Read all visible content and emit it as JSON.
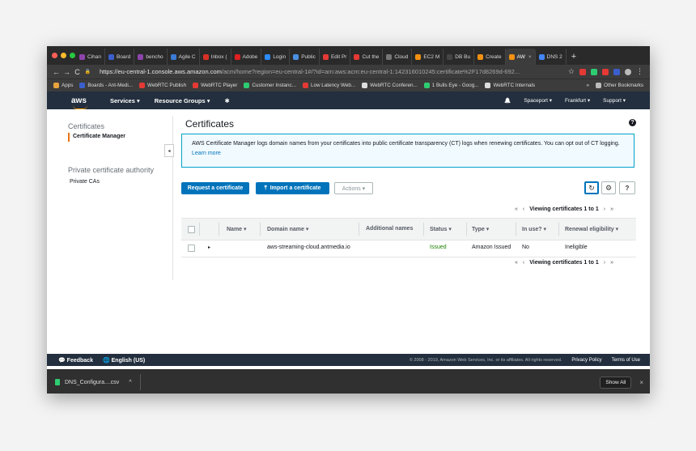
{
  "browser": {
    "tabs": [
      {
        "label": "Cihan",
        "color": "#8e44ad"
      },
      {
        "label": "Board",
        "color": "#3a5fcd"
      },
      {
        "label": "bencho",
        "color": "#8e44ad"
      },
      {
        "label": "Agile C",
        "color": "#3a7bd5"
      },
      {
        "label": "Inbox (",
        "color": "#d93025"
      },
      {
        "label": "Adobe",
        "color": "#e02020"
      },
      {
        "label": "Login",
        "color": "#2d8cff"
      },
      {
        "label": "Public",
        "color": "#4a90e2"
      },
      {
        "label": "Edit Pr",
        "color": "#e53935"
      },
      {
        "label": "Cut the",
        "color": "#e53935"
      },
      {
        "label": "Cloud",
        "color": "#777777"
      },
      {
        "label": "EC2 M",
        "color": "#f29111"
      },
      {
        "label": "DB Bu",
        "color": "#444444"
      },
      {
        "label": "Create",
        "color": "#f29111"
      },
      {
        "label": "AW",
        "color": "#f29111"
      },
      {
        "label": "DNS 2",
        "color": "#4285f4"
      }
    ],
    "new_tab": "+",
    "close_tab": "×",
    "back": "←",
    "forward": "→",
    "reload": "C",
    "lock": "🔒",
    "star": "☆",
    "url_host": "https://eu-central-1.console.aws.amazon.com",
    "url_path": "/acm/home?region=eu-central-1#/?id=arn:aws:acm:eu-central-1:142316010245:certificate%2F17d8269d-692...",
    "menu": "⋮",
    "bookmarks": [
      {
        "label": "Apps",
        "color": "#e8a33d"
      },
      {
        "label": "Boards - Ant-Medi...",
        "color": "#3a5fcd"
      },
      {
        "label": "WebRTC Publish",
        "color": "#e53935"
      },
      {
        "label": "WebRTC Player",
        "color": "#e53935"
      },
      {
        "label": "Customer Instanc...",
        "color": "#2ecc71"
      },
      {
        "label": "Low Latency Web...",
        "color": "#e53935"
      },
      {
        "label": "WebRTC Conferen...",
        "color": "#dddddd"
      },
      {
        "label": "1 Bulls Eye - Goog...",
        "color": "#2ecc71"
      },
      {
        "label": "WebRTC Internals",
        "color": "#dddddd"
      }
    ],
    "more_bookmarks": "»",
    "other_bookmarks": "Other Bookmarks"
  },
  "aws_nav": {
    "logo": "aws",
    "services": "Services",
    "resource_groups": "Resource Groups",
    "chevron": "▾",
    "pin": "✱",
    "bell": "🔔",
    "account": "Spaceport",
    "region": "Frankfurt",
    "support": "Support"
  },
  "sidebar": {
    "section1_title": "Certificates",
    "section1_item": "Certificate Manager",
    "section2_title": "Private certificate authority",
    "section2_item": "Private CAs",
    "collapse": "◂"
  },
  "main": {
    "title": "Certificates",
    "help": "?",
    "info_text": "AWS Certificate Manager logs domain names from your certificates into public certificate transparency (CT) logs when renewing certificates. You can opt out of CT logging.",
    "info_link": "Learn more",
    "request_button": "Request a certificate",
    "import_button": "Import a certificate",
    "import_icon": "⤒",
    "actions_button": "Actions ▾",
    "refresh": "↻",
    "settings": "⚙",
    "pager": {
      "first": "«",
      "prev": "‹",
      "text": "Viewing certificates 1 to 1",
      "next": "›",
      "last": "»"
    },
    "columns": [
      "Name",
      "Domain name",
      "Additional names",
      "Status",
      "Type",
      "In use?",
      "Renewal eligibility"
    ],
    "sort_icon": "▾",
    "row": {
      "expand": "▸",
      "name": "",
      "domain": "aws-streaming-cloud.antmedia.io",
      "additional": "",
      "status": "Issued",
      "type": "Amazon Issued",
      "in_use": "No",
      "renewal": "Ineligible"
    }
  },
  "footer": {
    "feedback": "Feedback",
    "language": "English (US)",
    "copyright": "© 2008 - 2019, Amazon Web Services, Inc. or its affiliates. All rights reserved.",
    "privacy": "Privacy Policy",
    "terms": "Terms of Use"
  },
  "downloads": {
    "file": "DNS_Configura....csv",
    "chevron": "^",
    "show_all": "Show All",
    "close": "×"
  },
  "colors": {
    "aws_nav": "#232f3e",
    "accent": "#ec7211",
    "primary": "#0073bb",
    "issued": "#1d8102"
  }
}
